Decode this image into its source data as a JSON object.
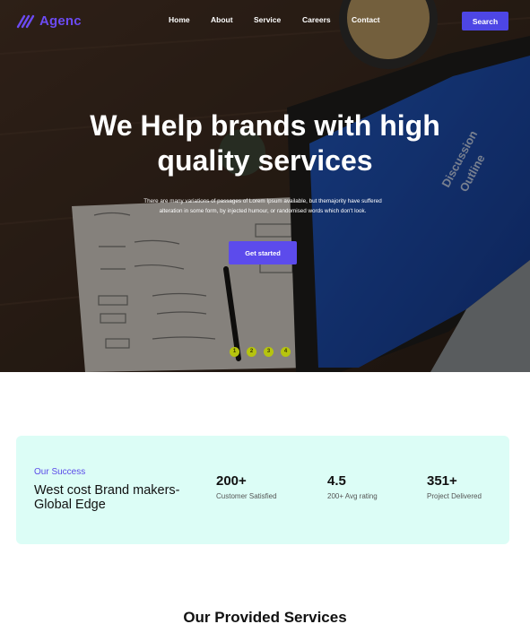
{
  "brand": {
    "name": "Agenc",
    "accent": "#6c4bf4"
  },
  "nav": {
    "items": [
      "Home",
      "About",
      "Service",
      "Careers",
      "Contact"
    ],
    "search_label": "Search"
  },
  "hero": {
    "title_line1": "We Help brands with high",
    "title_line2": "quality services",
    "description": "There are many variations of passages of Lorem Ipsum available, but themajority have suffered alteration in some form, by injected humour, or randomised words which don't look.",
    "cta_label": "Get started",
    "slides": [
      "1",
      "2",
      "3",
      "4"
    ],
    "laptop_text_1": "Discussion",
    "laptop_text_2": "Outline"
  },
  "stats": {
    "kicker": "Our Success",
    "title": "West cost Brand makers-Global Edge",
    "items": [
      {
        "value": "200+",
        "label": "Customer Satisfied"
      },
      {
        "value": "4.5",
        "label": "200+ Avg rating"
      },
      {
        "value": "351+",
        "label": "Project Delivered"
      }
    ]
  },
  "services": {
    "title": "Our Provided Services"
  },
  "colors": {
    "button": "#4d46e5",
    "stats_bg": "#dcfdf6",
    "dot": "#b6c40e"
  }
}
